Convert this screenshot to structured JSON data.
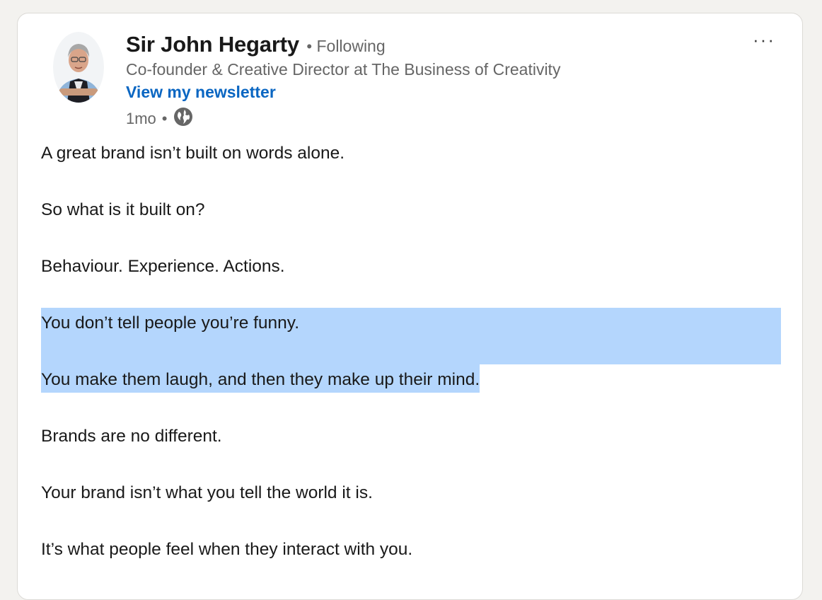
{
  "post": {
    "author": {
      "name": "Sir John Hegarty",
      "separator": "•",
      "follow_status": "Following",
      "headline": "Co-founder & Creative Director at The Business of Creativity",
      "newsletter_link": "View my newsletter"
    },
    "meta": {
      "age": "1mo",
      "separator": "•",
      "visibility_icon": "globe-icon"
    },
    "menu_icon": "more-options-icon",
    "menu_label": "···",
    "highlight_color": "#b4d6fd",
    "link_color": "#0a66c2",
    "lines": [
      "A great brand isn’t built on words alone.",
      "So what is it built on?",
      "Behaviour. Experience. Actions.",
      "You don’t tell people you’re funny.",
      "You make them laugh, and then they make up their mind.",
      "Brands are no different.",
      "Your brand isn’t what you tell the world it is.",
      "It’s what people feel when they interact with you."
    ]
  }
}
